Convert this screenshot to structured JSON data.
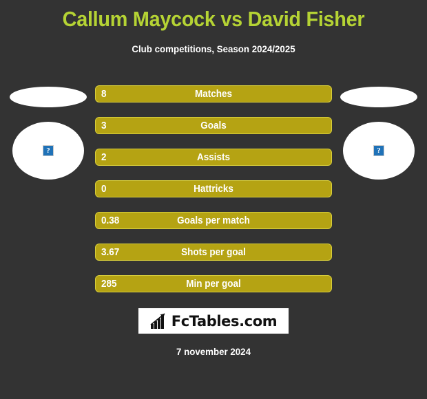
{
  "header": {
    "title": "Callum Maycock vs David Fisher",
    "subtitle": "Club competitions, Season 2024/2025",
    "title_color": "#b5d334",
    "subtitle_color": "#ffffff"
  },
  "theme": {
    "background": "#333333",
    "bar_fill": "#b5a313",
    "bar_border": "#d9cf3c",
    "bar_text": "#ffffff"
  },
  "players": {
    "left": {
      "name": "Callum Maycock",
      "club_badge": "club-badge-placeholder",
      "photo": "broken-image-placeholder",
      "photo_glyph": "?"
    },
    "right": {
      "name": "David Fisher",
      "club_badge": "club-badge-placeholder",
      "photo": "broken-image-placeholder",
      "photo_glyph": "?"
    }
  },
  "stats": [
    {
      "label": "Matches",
      "value": "8"
    },
    {
      "label": "Goals",
      "value": "3"
    },
    {
      "label": "Assists",
      "value": "2"
    },
    {
      "label": "Hattricks",
      "value": "0"
    },
    {
      "label": "Goals per match",
      "value": "0.38"
    },
    {
      "label": "Shots per goal",
      "value": "3.67"
    },
    {
      "label": "Min per goal",
      "value": "285"
    }
  ],
  "logo": {
    "icon": "bar-chart-growth-icon",
    "text": "FcTables.com"
  },
  "footer": {
    "date": "7 november 2024"
  }
}
